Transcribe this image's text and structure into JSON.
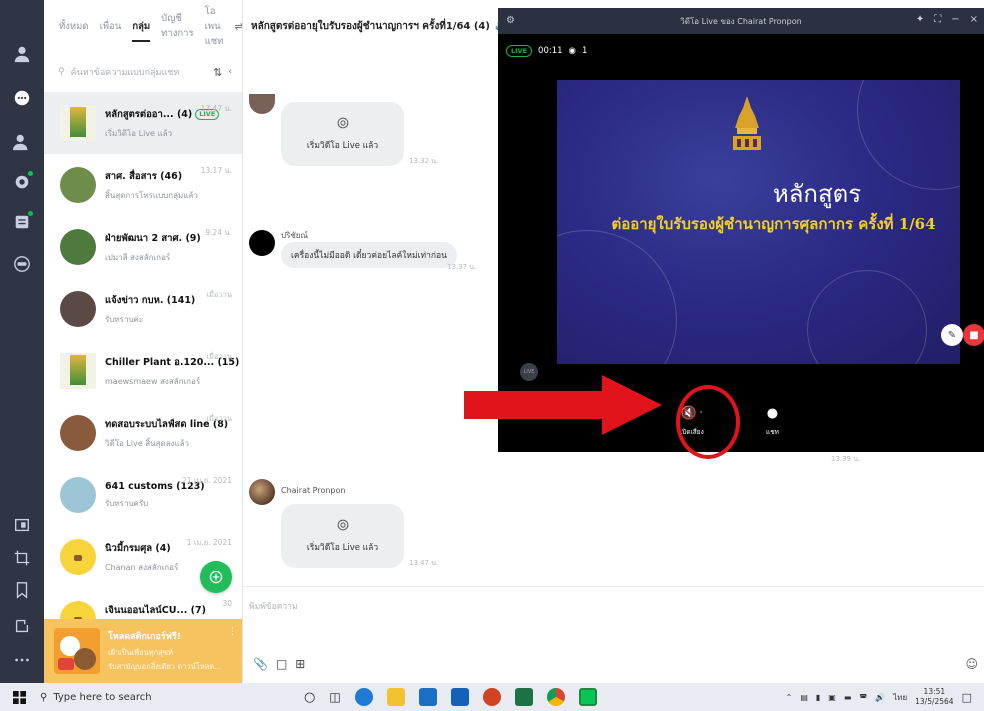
{
  "list": {
    "tabs": [
      "ทั้งหมด",
      "เพื่อน",
      "กลุ่ม",
      "บัญชีทางการ",
      "โอเพนแชท"
    ],
    "active_tab": "กลุ่ม",
    "search_placeholder": "ค้นหาข้อความแบบกลุ่มแชท",
    "chats": [
      {
        "title": "หลักสูตรต่ออา... (4)",
        "live": "LIVE",
        "sub": "เริ่มวิดีโอ Live แล้ว",
        "time": "13.47 น.",
        "color": "#f2f2e6"
      },
      {
        "title": "สาศ. สื่อสาร (46)",
        "sub": "สิ้นสุดการโทรแบบกลุ่มแล้ว",
        "time": "13.17 น.",
        "color": "#6f8d4a"
      },
      {
        "title": "ฝ่ายพัฒนา 2 สาศ. (9)",
        "sub": "เปมาลี สงสลักเกอร์",
        "time": "9.24 น.",
        "color": "#4f7a3d"
      },
      {
        "title": "แจ้งข่าว กบห. (141)",
        "sub": "รับทราบค่ะ",
        "time": "เมื่อวาน",
        "color": "#5b4a44"
      },
      {
        "title": "Chiller Plant อ.120... (15)",
        "sub": "maewsmaew สงสลักเกอร์",
        "time": "เมื่อวาน",
        "color": "#f2f2e6"
      },
      {
        "title": "ทดสอบระบบไลฟ์สด line (8)",
        "sub": "วิดีโอ Live สิ้นสุดลงแล้ว",
        "time": "เมื่อวาน",
        "color": "#8a5a3c"
      },
      {
        "title": "641 customs (123)",
        "sub": "รับทราบครับ",
        "time": "21 เม.ย. 2021",
        "color": "#9cc6d6"
      },
      {
        "title": "นิวมี้กรมศุล (4)",
        "sub": "Chanan สงสลักเกอร์",
        "time": "1 เม.ย. 2021",
        "color": "#f7d43a"
      },
      {
        "title": "เจินนออนไลน์CU... (7)",
        "sub": "วิดีโอ Live สิ้นสุดลงแล้ว",
        "time": "30",
        "color": "#f7d43a"
      }
    ],
    "promo_title": "โหลดสติกเกอร์ฟรี!",
    "promo_sub1": "เฝ้าเป็นเพื่อนทุกสุขท์",
    "promo_sub2": "รับสามัญบอกสิ่งเดียว ดาวน์โหลด..."
  },
  "conv": {
    "title": "หลักสูตรต่ออายุใบรับรองผู้ชำนาญการฯ ครั้งที่1/64 (4)",
    "live_started": "เริ่มวิดีโอ Live แล้ว",
    "time1": "13.32 น.",
    "sender1": "ปริชัยณ์",
    "message1": "เครื่องนี้ไม่มีออดิ เดี๋ยวค่อยไลค์ใหม่เท่าก่อน",
    "time2": "13.37 น.",
    "time3": "13.39 น.",
    "sender2": "Chairat Pronpon",
    "time4": "13.47 น.",
    "composer_placeholder": "พิมพ์ข้อความ"
  },
  "video": {
    "window_title": "วิดีโอ Live ของ Chairat Pronpon",
    "live": "LIVE",
    "elapsed": "00:11",
    "viewers": "1",
    "slide_title": "หลักสูตร",
    "slide_subtitle": "ต่ออายุใบรับรองผู้ชำนาญการศุลกากร ครั้งที่ 1/64",
    "mute_label": "เปิดเสียง",
    "chat_label": "แชท",
    "live_mini": "LIVE"
  },
  "taskbar": {
    "search_placeholder": "Type here to search",
    "lang": "ไทย",
    "time": "13:51",
    "date": "13/5/2564"
  },
  "colors": {
    "line_green": "#14b84a",
    "annotation_red": "#e1141c",
    "rail": "#2f3545"
  }
}
